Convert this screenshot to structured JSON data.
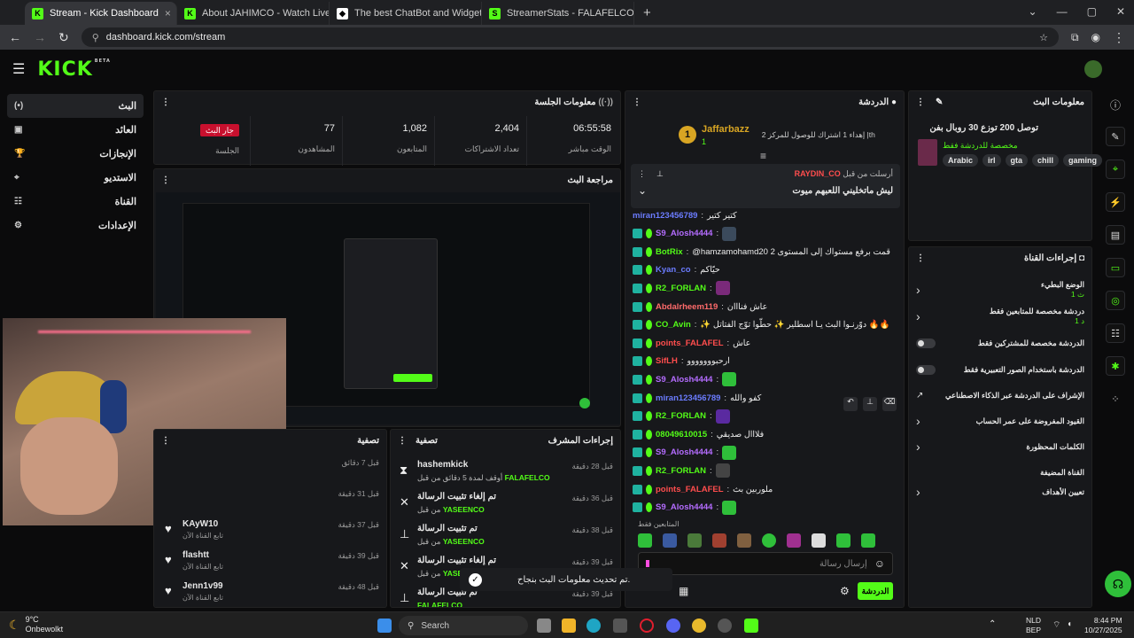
{
  "browser": {
    "tabs": [
      {
        "title": "Stream - Kick Dashboard",
        "fav": "K",
        "color": "#53fc18"
      },
      {
        "title": "About JAHIMCO - Watch Live o",
        "fav": "K",
        "color": "#53fc18"
      },
      {
        "title": "The best ChatBot and Widgets",
        "fav": "◆",
        "color": "#ffffff"
      },
      {
        "title": "StreamerStats - FALAFELCO Pro",
        "fav": "S",
        "color": "#53fc18"
      }
    ],
    "url": "dashboard.kick.com/stream"
  },
  "kick": {
    "logo": "KICK",
    "beta": "BETA"
  },
  "sidebar": {
    "items": [
      {
        "label": "البث",
        "icon": "(•)"
      },
      {
        "label": "العائد",
        "icon": "▣"
      },
      {
        "label": "الإنجازات",
        "icon": "🏆"
      },
      {
        "label": "الاستديو",
        "icon": "⌖"
      },
      {
        "label": "القناة",
        "icon": "☷"
      },
      {
        "label": "الإعدادات",
        "icon": "⚙"
      }
    ]
  },
  "session": {
    "title": "معلومات الجلسة",
    "stats": [
      {
        "value": "06:55:58",
        "label": "الوقت مباشر"
      },
      {
        "value": "2,404",
        "label": "تعداد الاشتراكات"
      },
      {
        "value": "1,082",
        "label": "المتابعون"
      },
      {
        "value": "77",
        "label": "المشاهدون"
      }
    ],
    "live_badge": "جار البث",
    "live_label": "الجلسة"
  },
  "preview": {
    "title": "مراجعة البث"
  },
  "activity": {
    "title": "تصفية",
    "items": [
      {
        "time": "قبل 7 دقائق",
        "name": "",
        "sub": ""
      },
      {
        "time": "قبل 31 دقيقة",
        "name": "",
        "sub": ""
      },
      {
        "time": "قبل 37 دقيقة",
        "name": "KAyW10",
        "sub": "تابع القناة الآن"
      },
      {
        "time": "قبل 39 دقيقة",
        "name": "flashtt",
        "sub": "تابع القناة الآن"
      },
      {
        "time": "قبل 48 دقيقة",
        "name": "Jenn1v99",
        "sub": "تابع القناة الآن"
      }
    ]
  },
  "mod": {
    "title": "إجراءات المشرف",
    "filter": "تصفية",
    "items": [
      {
        "time": "قبل 28 دقيقة",
        "title": "hashemkick",
        "sub": "أوقف لمدة 5 دقائق من قبل",
        "by": "FALAFELCO",
        "icon": "⧗"
      },
      {
        "time": "قبل 36 دقيقة",
        "title": "تم إلغاء تثبيت الرسالة",
        "sub": "من قبل",
        "by": "YASEENCO",
        "icon": "✕"
      },
      {
        "time": "قبل 38 دقيقة",
        "title": "تم تثبيت الرسالة",
        "sub": "من قبل",
        "by": "YASEENCO",
        "icon": "⊥"
      },
      {
        "time": "قبل 39 دقيقة",
        "title": "تم إلغاء تثبيت الرسالة",
        "sub": "من قبل",
        "by": "YASEEN",
        "icon": "✕"
      },
      {
        "time": "قبل 39 دقيقة",
        "title": "تم تثبيت الرسالة",
        "sub": "",
        "by": "FALAFELCO",
        "icon": "⊥"
      }
    ]
  },
  "chat": {
    "title": "الدردشة",
    "top_user": "Jaffarbazz",
    "top_rank": "1",
    "top_count": "1",
    "top_msg": "إهداء 1 اشتراك للوصول للمركز 2 |th",
    "pinned_by": "أرسلت من قبل",
    "pinned_user": "RAYDIN_CO",
    "pinned_text": "ليش ماتخليني اللعبهم ميوت",
    "messages": [
      {
        "user": "miran123456789",
        "color": "#6b7cff",
        "text": "كتير كتير",
        "emo": ""
      },
      {
        "user": "S9_Alosh4444",
        "color": "#b46cff",
        "text": "",
        "emo": "#3b4a5c"
      },
      {
        "user": "BotRix",
        "color": "#53fc18",
        "text": "@hamzamohamd20 قمت برفع مستواك إلى المستوى 2",
        "emo": ""
      },
      {
        "user": "Kyan_co",
        "color": "#6b7cff",
        "text": "حيّاكم",
        "emo": ""
      },
      {
        "user": "R2_FORLAN",
        "color": "#53fc18",
        "text": "",
        "emo": "#7a2a7a"
      },
      {
        "user": "Abdalrheem119",
        "color": "#ff6b6b",
        "text": "عاش فنااان",
        "emo": ""
      },
      {
        "user": "CO_Avin",
        "color": "#53fc18",
        "text": "✨ دوّرنـوا البث يـا اسطلير ✨ حطّوا توّج الفتاتل 🔥🔥",
        "emo": ""
      },
      {
        "user": "points_FALAFEL",
        "color": "#ff4d4d",
        "text": "عاش",
        "emo": ""
      },
      {
        "user": "SifLH",
        "color": "#ff4d4d",
        "text": "ارحبووووووو",
        "emo": ""
      },
      {
        "user": "S9_Alosh4444",
        "color": "#b46cff",
        "text": "",
        "emo": "#2fbf3a"
      },
      {
        "user": "miran123456789",
        "color": "#6b7cff",
        "text": "كفو والله",
        "emo": ""
      },
      {
        "user": "R2_FORLAN",
        "color": "#53fc18",
        "text": "",
        "emo": "#5a2aa0"
      },
      {
        "user": "08049610015",
        "color": "#53fc18",
        "text": "فلااال صديقي",
        "emo": ""
      },
      {
        "user": "S9_Alosh4444",
        "color": "#b46cff",
        "text": "",
        "emo": "#2fbf3a"
      },
      {
        "user": "R2_FORLAN",
        "color": "#53fc18",
        "text": "",
        "emo": "#444"
      },
      {
        "user": "points_FALAFEL",
        "color": "#ff4d4d",
        "text": "ملوربين بث",
        "emo": ""
      },
      {
        "user": "S9_Alosh4444",
        "color": "#b46cff",
        "text": "",
        "emo": "#2fbf3a"
      }
    ],
    "followers_only": "المتابعين فقط",
    "input_placeholder": "إرسال رسالة",
    "send": "الدردشة"
  },
  "toast": "تم تحديث معلومات البث بنجاح.",
  "stream_info": {
    "title": "معلومات البث",
    "stream_title": "توصل 200 توزع 30 روبال بفن",
    "category": "مخصصة للدردشة فقط",
    "tags": [
      "Arabic",
      "irl",
      "gta",
      "chill",
      "gaming"
    ]
  },
  "channel_actions": {
    "title": "إجراءات القناة",
    "items": [
      {
        "label": "الوضع البطيء",
        "sub": "1 ث",
        "type": "chevron"
      },
      {
        "label": "دردشة مخصصة للمتابعين فقط",
        "sub": "1 د",
        "type": "chevron"
      },
      {
        "label": "الدردشة مخصصة للمشتركين فقط",
        "sub": "",
        "type": "toggle"
      },
      {
        "label": "الدردشة باستخدام الصور التعبيرية فقط",
        "sub": "",
        "type": "toggle"
      },
      {
        "label": "الإشراف على الدردشة عبر الذكاء الاصطناعي",
        "sub": "",
        "type": "ext"
      },
      {
        "label": "القيود المفروضة على عمر الحساب",
        "sub": "",
        "type": "chevron"
      },
      {
        "label": "الكلمات المحظورة",
        "sub": "",
        "type": "chevron"
      },
      {
        "label": "القناة المضيفة",
        "sub": "",
        "type": "none"
      },
      {
        "label": "تعيين الأهداف",
        "sub": "",
        "type": "chevron"
      }
    ]
  },
  "taskbar": {
    "weather_temp": "9°C",
    "weather_desc": "Onbewolkt",
    "search": "Search",
    "lang": "NLD",
    "lang2": "BEP",
    "time": "8:44 PM",
    "date": "10/27/2025"
  }
}
